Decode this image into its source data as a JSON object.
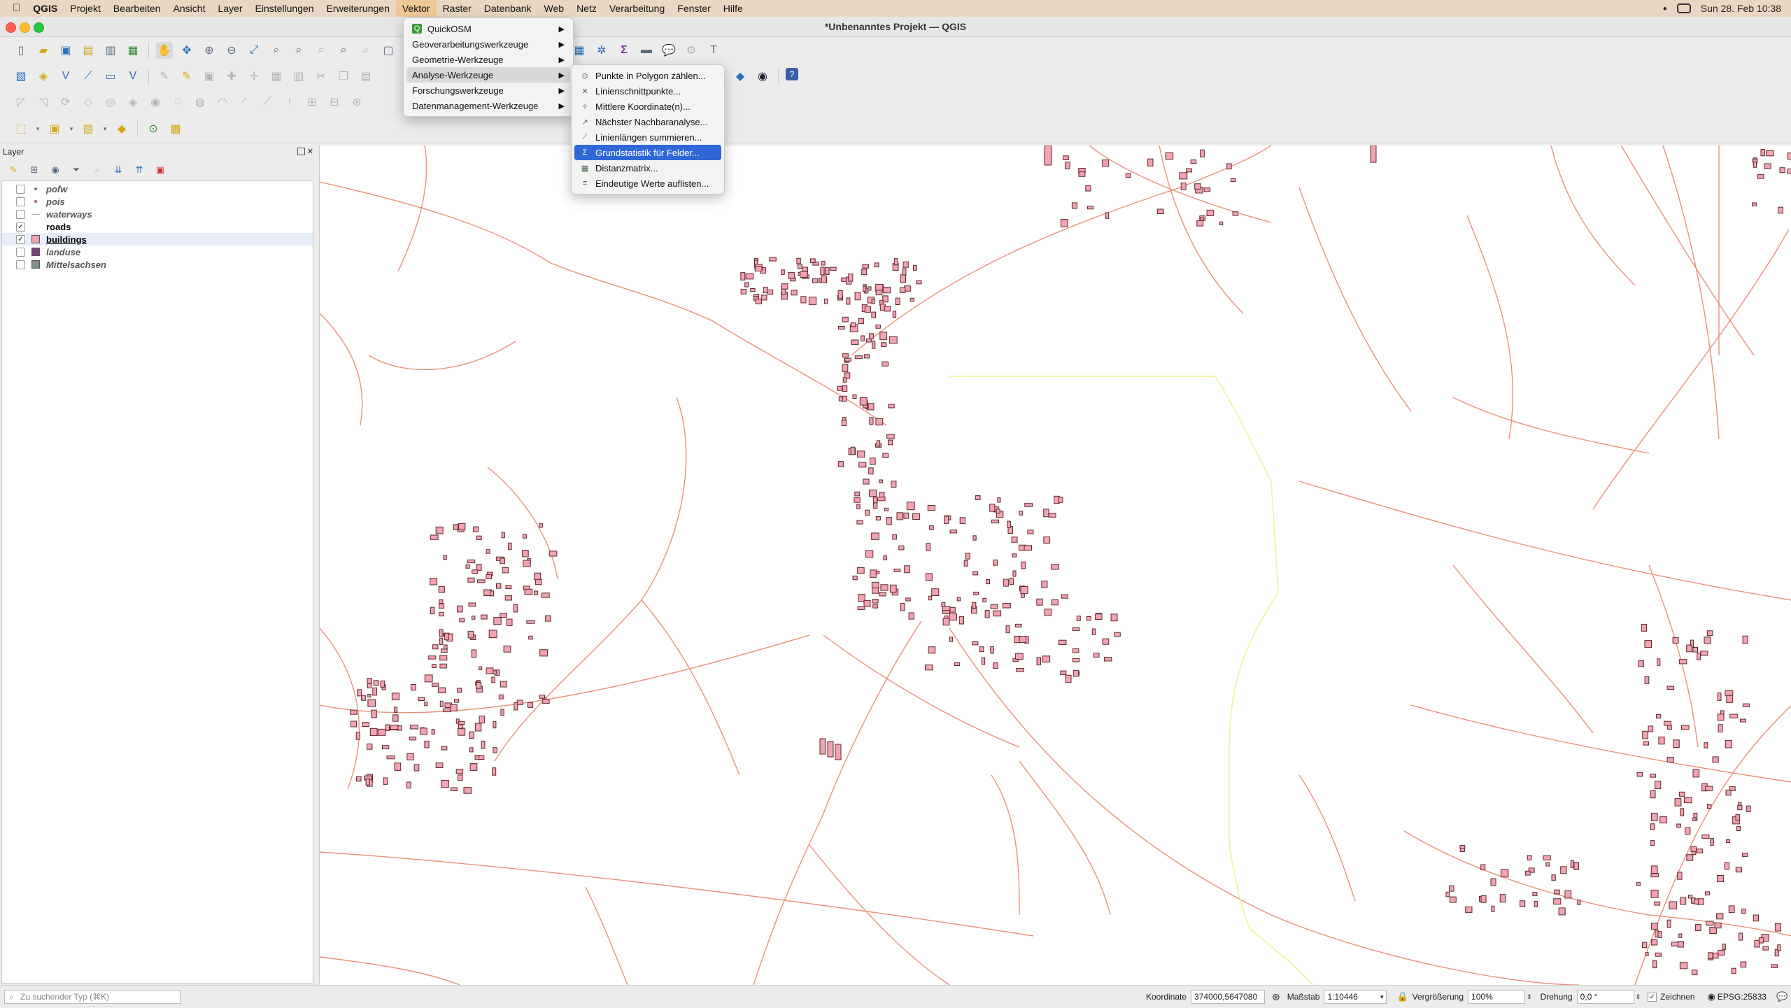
{
  "menubar": {
    "app": "QGIS",
    "items": [
      "Projekt",
      "Bearbeiten",
      "Ansicht",
      "Layer",
      "Einstellungen",
      "Erweiterungen",
      "Vektor",
      "Raster",
      "Datenbank",
      "Web",
      "Netz",
      "Verarbeitung",
      "Fenster",
      "Hilfe"
    ],
    "active": "Vektor",
    "clock": "Sun 28. Feb  10:38"
  },
  "window": {
    "title": "*Unbenanntes Projekt — QGIS"
  },
  "vector_menu": {
    "items": [
      {
        "label": "QuickOSM",
        "icon": "quickosm-icon",
        "submenu": true
      },
      {
        "label": "Geoverarbeitungswerkzeuge",
        "submenu": true
      },
      {
        "label": "Geometrie-Werkzeuge",
        "submenu": true
      },
      {
        "label": "Analyse-Werkzeuge",
        "submenu": true,
        "open": true
      },
      {
        "label": "Forschungswerkzeuge",
        "submenu": true
      },
      {
        "label": "Datenmanagement-Werkzeuge",
        "submenu": true
      }
    ]
  },
  "analysis_submenu": {
    "items": [
      {
        "label": "Punkte in Polygon zählen...",
        "icon": "count-points-icon"
      },
      {
        "label": "Linienschnittpunkte...",
        "icon": "line-intersection-icon"
      },
      {
        "label": "Mittlere Koordinate(n)...",
        "icon": "mean-coordinate-icon"
      },
      {
        "label": "Nächster Nachbaranalyse...",
        "icon": "nearest-neighbour-icon"
      },
      {
        "label": "Linienlängen summieren...",
        "icon": "sum-line-lengths-icon"
      },
      {
        "label": "Grundstatistik für Felder...",
        "icon": "basic-statistics-icon",
        "highlighted": true
      },
      {
        "label": "Distanzmatrix...",
        "icon": "distance-matrix-icon"
      },
      {
        "label": "Eindeutige Werte auflisten...",
        "icon": "list-unique-values-icon"
      }
    ]
  },
  "layers_panel": {
    "title": "Layer",
    "layers": [
      {
        "name": "pofw",
        "checked": false,
        "symbol": "point",
        "color": "#9b6a5a"
      },
      {
        "name": "pois",
        "checked": false,
        "symbol": "point",
        "color": "#9b6a5a"
      },
      {
        "name": "waterways",
        "checked": false,
        "symbol": "line",
        "color": "#b9a6c9"
      },
      {
        "name": "roads",
        "checked": true,
        "symbol": "none",
        "color": "#e08060"
      },
      {
        "name": "buildings",
        "checked": true,
        "symbol": "fill",
        "color": "#f0a0b0",
        "selected": true
      },
      {
        "name": "landuse",
        "checked": false,
        "symbol": "fill",
        "color": "#7a3f7a"
      },
      {
        "name": "Mittelsachsen",
        "checked": false,
        "symbol": "fill",
        "color": "#7f8f86"
      }
    ]
  },
  "status": {
    "search_placeholder": "Zu suchender Typ (⌘K)",
    "coordinate_label": "Koordinate",
    "coordinate_value": "374000,5647080",
    "scale_label": "Maßstab",
    "scale_value": "1:10446",
    "magnifier_label": "Vergrößerung",
    "magnifier_value": "100%",
    "rotation_label": "Drehung",
    "rotation_value": "0,0 °",
    "render_label": "Zeichnen",
    "render_checked": true,
    "crs": "EPSG:25833"
  },
  "colors": {
    "roads": "#e8917a",
    "buildings_fill": "#f3a3b4",
    "buildings_stroke": "#5a2a2a",
    "highlight_line": "#f5ef9a",
    "menu_highlight": "#2f68d6"
  }
}
